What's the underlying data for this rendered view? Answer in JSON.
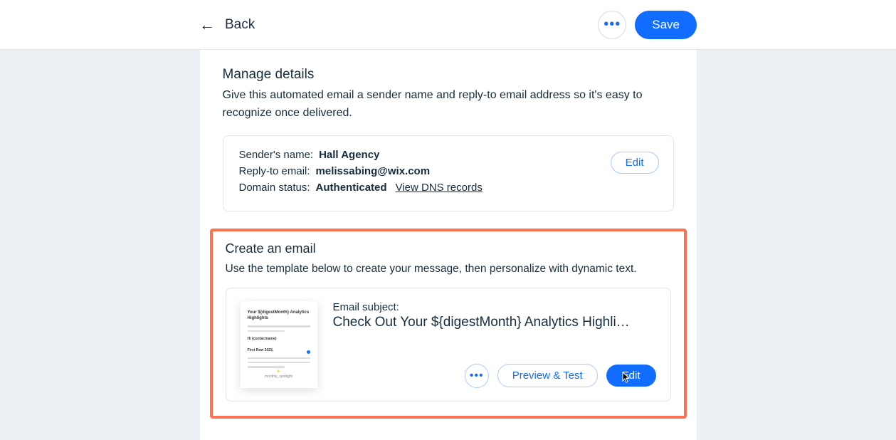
{
  "header": {
    "back_label": "Back",
    "save_label": "Save"
  },
  "manage": {
    "title": "Manage details",
    "description": "Give this automated email a sender name and reply-to email address so it's easy to recognize once delivered.",
    "sender_label": "Sender's name:",
    "sender_value": "Hall Agency",
    "reply_label": "Reply-to email:",
    "reply_value": "melissabing@wix.com",
    "domain_label": "Domain status:",
    "domain_value": "Authenticated",
    "dns_link": "View DNS records",
    "edit_label": "Edit"
  },
  "create": {
    "title": "Create an email",
    "description": "Use the template below to create your message, then personalize with dynamic text.",
    "subject_label": "Email subject:",
    "subject_value": "Check Out Your ${digestMonth} Analytics Highli…",
    "preview_label": "Preview & Test",
    "edit_label": "Edit"
  }
}
